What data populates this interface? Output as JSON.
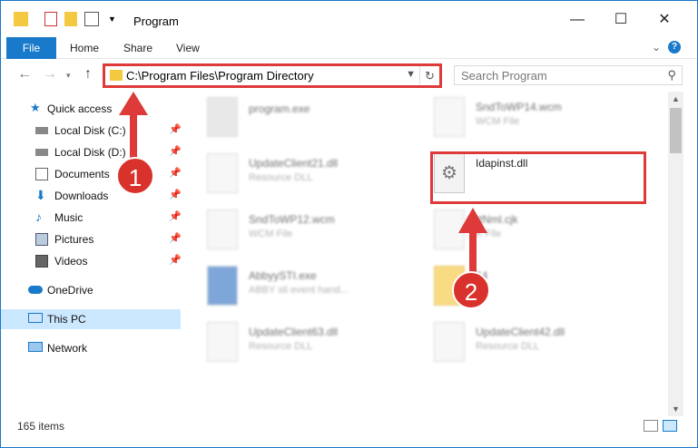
{
  "window": {
    "title": "Program"
  },
  "ribbon": {
    "file": "File",
    "home": "Home",
    "share": "Share",
    "view": "View",
    "help": "?"
  },
  "address": {
    "path": "C:\\Program Files\\Program Directory",
    "search_placeholder": "Search Program"
  },
  "navpane": {
    "quick_access": "Quick access",
    "items": [
      {
        "label": "Local Disk (C:)",
        "icon": "drive-icon",
        "pinned": true
      },
      {
        "label": "Local Disk (D:)",
        "icon": "drive-icon",
        "pinned": true
      },
      {
        "label": "Documents",
        "icon": "documents-icon",
        "pinned": true
      },
      {
        "label": "Downloads",
        "icon": "downloads-icon",
        "pinned": true
      },
      {
        "label": "Music",
        "icon": "music-icon",
        "pinned": true
      },
      {
        "label": "Pictures",
        "icon": "pictures-icon",
        "pinned": true
      },
      {
        "label": "Videos",
        "icon": "videos-icon",
        "pinned": true
      }
    ],
    "onedrive": "OneDrive",
    "thispc": "This PC",
    "network": "Network"
  },
  "files": [
    {
      "name": "program.exe",
      "type": ""
    },
    {
      "name": "SndToWP14.wcm",
      "type": "WCM File"
    },
    {
      "name": "UpdateClient21.dll",
      "type": "Resource DLL"
    },
    {
      "name": "Idapinst.dll",
      "type": ""
    },
    {
      "name": "SndToWP12.wcm",
      "type": "WCM File"
    },
    {
      "name": "rtNml.cjk",
      "type": "K File"
    },
    {
      "name": "AbbyySTI.exe",
      "type": "ABBY sti event hand..."
    },
    {
      "name": "64",
      "type": ""
    },
    {
      "name": "UpdateClient63.dll",
      "type": "Resource DLL"
    },
    {
      "name": "UpdateClient42.dll",
      "type": "Resource DLL"
    }
  ],
  "status": {
    "count": "165 items"
  },
  "annotations": {
    "step1": "1",
    "step2": "2"
  },
  "colors": {
    "accent": "#1979ca",
    "highlight": "#de3a3a",
    "folder": "#f5c842"
  }
}
